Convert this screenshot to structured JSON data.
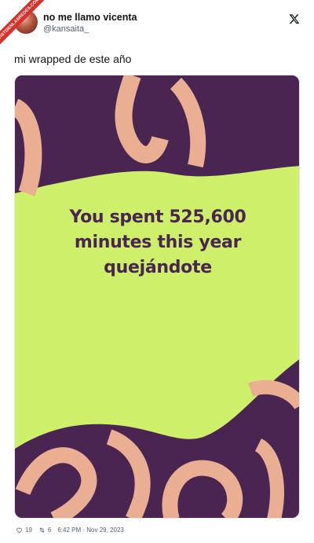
{
  "author": {
    "display_name": "no me llamo vicenta",
    "handle": "@kansaita_"
  },
  "tweet": {
    "text": "mi wrapped de este año"
  },
  "media": {
    "lines": [
      "You spent 525,600",
      "minutes this year",
      "quejándote"
    ],
    "colors": {
      "background": "#cdef6a",
      "purple": "#4a2552",
      "peach": "#eaae92"
    }
  },
  "footer": {
    "likes": "19",
    "retweets": "6",
    "timestamp": "6:42 PM · Nov 29, 2023"
  },
  "watermark": {
    "text": "VISTOENLASREDES.COM"
  },
  "icons": {
    "platform": "x-logo-icon",
    "like": "heart-icon",
    "retweet": "retweet-icon"
  }
}
